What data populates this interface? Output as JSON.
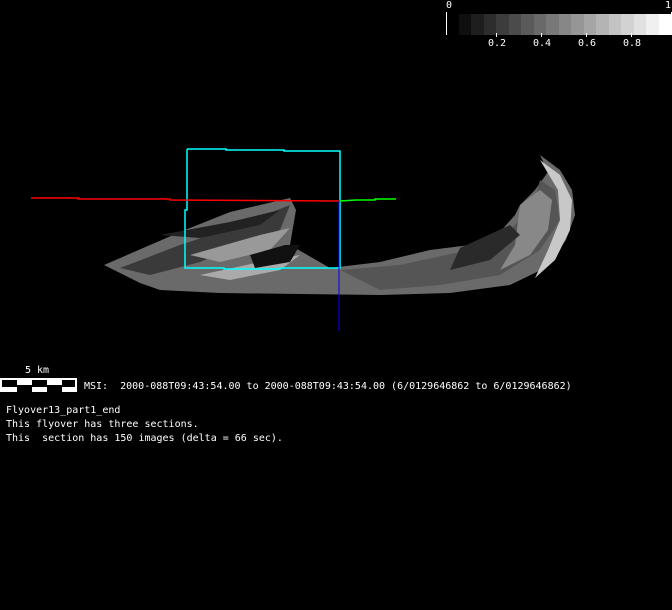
{
  "colorbar": {
    "min_label": "0",
    "max_label": "1",
    "tick_labels": [
      "0.2",
      "0.4",
      "0.6",
      "0.8"
    ],
    "steps": 17
  },
  "scale_bar": {
    "label": "5 km"
  },
  "info": {
    "msi_line": "MSI:  2000-088T09:43:54.00 to 2000-088T09:43:54.00 (6/0129646862 to 6/0129646862)",
    "title": "Flyover13_part1_end",
    "line1": "This flyover has three sections.",
    "line2": "This  section has 150 images (delta = 66 sec)."
  },
  "colors": {
    "frame": "#00ffff",
    "axis_x": "#ff0000",
    "axis_y": "#00ff00",
    "axis_z": "#0000ff"
  }
}
